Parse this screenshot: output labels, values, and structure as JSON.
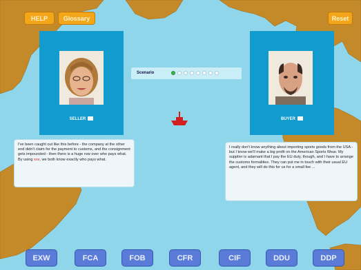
{
  "colors": {
    "ocean": "#8fd6ea",
    "land": "#c48a2a",
    "panel": "#129bcf",
    "button": "#f3a61a",
    "term": "#5a7bd8",
    "ship": "#d41f1f"
  },
  "top_buttons": {
    "help": "HELP",
    "glossary": "Glossary",
    "reset": "Reset"
  },
  "seller": {
    "name": "SELLER",
    "speaker_icon": "speaker-icon"
  },
  "buyer": {
    "name": "BUYER",
    "speaker_icon": "speaker-icon"
  },
  "progress": {
    "label": "Scenario",
    "total": 8,
    "completed": 1
  },
  "seller_text": {
    "before": "I've been caught out like this before - the company at the other end didn't claim for the payment to customs, and the consignment gets impounded - then there is a huge row over who pays what. By using ",
    "highlight": "xxx",
    "after": ", we both know exactly who pays what."
  },
  "buyer_text": "I really don't know anything about importing sports goods from the USA - but I know we'll make a big profit on the American Sports Wear. My supplier is adamant that I pay the EU duty, though, and I have to arrange the customs formalities. They can put me in touch with their usual EU agent, and they will do this for us for a small fee ...",
  "incoterms": [
    "EXW",
    "FCA",
    "FOB",
    "CFR",
    "CIF",
    "DDU",
    "DDP"
  ]
}
